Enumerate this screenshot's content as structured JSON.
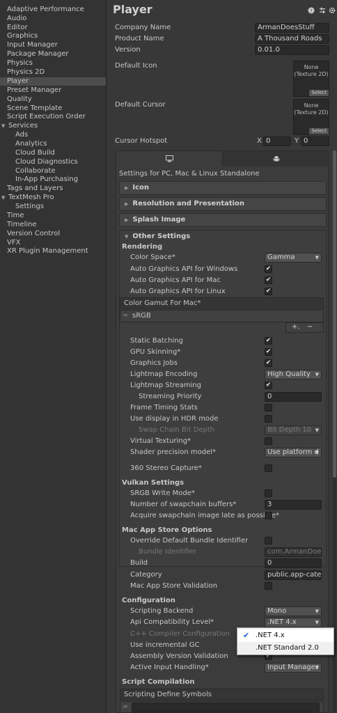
{
  "sidebar": {
    "items": [
      {
        "label": "Adaptive Performance"
      },
      {
        "label": "Audio"
      },
      {
        "label": "Editor"
      },
      {
        "label": "Graphics"
      },
      {
        "label": "Input Manager"
      },
      {
        "label": "Package Manager"
      },
      {
        "label": "Physics"
      },
      {
        "label": "Physics 2D"
      },
      {
        "label": "Player"
      },
      {
        "label": "Preset Manager"
      },
      {
        "label": "Quality"
      },
      {
        "label": "Scene Template"
      },
      {
        "label": "Script Execution Order"
      },
      {
        "label": "Services"
      },
      {
        "label": "Ads"
      },
      {
        "label": "Analytics"
      },
      {
        "label": "Cloud Build"
      },
      {
        "label": "Cloud Diagnostics"
      },
      {
        "label": "Collaborate"
      },
      {
        "label": "In-App Purchasing"
      },
      {
        "label": "Tags and Layers"
      },
      {
        "label": "TextMesh Pro"
      },
      {
        "label": "Settings"
      },
      {
        "label": "Time"
      },
      {
        "label": "Timeline"
      },
      {
        "label": "Version Control"
      },
      {
        "label": "VFX"
      },
      {
        "label": "XR Plugin Management"
      }
    ]
  },
  "header": {
    "title": "Player",
    "icons": [
      "help-icon",
      "presets-icon",
      "settings-gear-icon"
    ]
  },
  "player": {
    "company_label": "Company Name",
    "company_value": "ArmanDoesStuff",
    "product_label": "Product Name",
    "product_value": "A Thousand Roads",
    "version_label": "Version",
    "version_value": "0.01.0",
    "default_icon_label": "Default Icon",
    "default_cursor_label": "Default Cursor",
    "texture_none": "None",
    "texture_type": "(Texture 2D)",
    "texture_select": "Select",
    "hotspot_label": "Cursor Hotspot",
    "hotspot_x_label": "X",
    "hotspot_x": "0",
    "hotspot_y_label": "Y",
    "hotspot_y": "0"
  },
  "platform": {
    "tabs": [
      "desktop-icon",
      "android-icon"
    ],
    "settings_title": "Settings for PC, Mac & Linux Standalone"
  },
  "foldouts": {
    "icon": "Icon",
    "resolution": "Resolution and Presentation",
    "splash": "Splash Image",
    "other": "Other Settings"
  },
  "rendering": {
    "header": "Rendering",
    "color_space_label": "Color Space*",
    "color_space_value": "Gamma",
    "auto_win_label": "Auto Graphics API  for Windows",
    "auto_mac_label": "Auto Graphics API  for Mac",
    "auto_linux_label": "Auto Graphics API  for Linux",
    "gamut_header": "Color Gamut For Mac*",
    "gamut_item": "sRGB",
    "add_label": "+.",
    "remove_label": "−",
    "static_batching": "Static Batching",
    "gpu_skinning": "GPU Skinning*",
    "graphics_jobs": "Graphics Jobs",
    "lightmap_encoding_label": "Lightmap Encoding",
    "lightmap_encoding_value": "High Quality",
    "lightmap_streaming": "Lightmap Streaming",
    "streaming_priority_label": "Streaming Priority",
    "streaming_priority_value": "0",
    "frame_timing": "Frame Timing Stats",
    "hdr_display": "Use display in HDR mode",
    "swap_chain_label": "Swap Chain Bit Depth",
    "swap_chain_value": "Bit Depth 10",
    "virtual_texturing": "Virtual Texturing*",
    "shader_precision_label": "Shader precision model*",
    "shader_precision_value": "Use platform d",
    "stereo_capture": "360 Stereo Capture*"
  },
  "vulkan": {
    "header": "Vulkan Settings",
    "srgb_write": "SRGB Write Mode*",
    "swapchain_buffers_label": "Number of swapchain buffers*",
    "swapchain_buffers_value": "3",
    "acquire_late": "Acquire swapchain image late as possible*"
  },
  "mac_store": {
    "header": "Mac App Store Options",
    "override_bundle": "Override Default Bundle Identifier",
    "bundle_id_label": "Bundle Identifier",
    "bundle_id_value": "com.ArmanDoesS",
    "build_label": "Build",
    "build_value": "0",
    "category_label": "Category",
    "category_value": "public.app-categ",
    "validation": "Mac App Store Validation"
  },
  "configuration": {
    "header": "Configuration",
    "backend_label": "Scripting Backend",
    "backend_value": "Mono",
    "api_label": "Api Compatibility Level*",
    "api_value": ".NET 4.x",
    "cpp_label": "C++ Compiler Configuration",
    "incremental_gc": "Use incremental GC",
    "assembly_validation": "Assembly Version Validation",
    "input_handling_label": "Active Input Handling*",
    "input_handling_value": "Input Manager"
  },
  "script_compilation": {
    "header": "Script Compilation",
    "define_symbols": "Scripting Define Symbols"
  },
  "popup": {
    "options": [
      ".NET 4.x",
      ".NET Standard 2.0"
    ],
    "selected": ".NET 4.x"
  },
  "colors": {
    "background": "#383838",
    "sidebar": "#333333",
    "selected": "#4d4d4d",
    "popup_check": "#1a66c9"
  }
}
